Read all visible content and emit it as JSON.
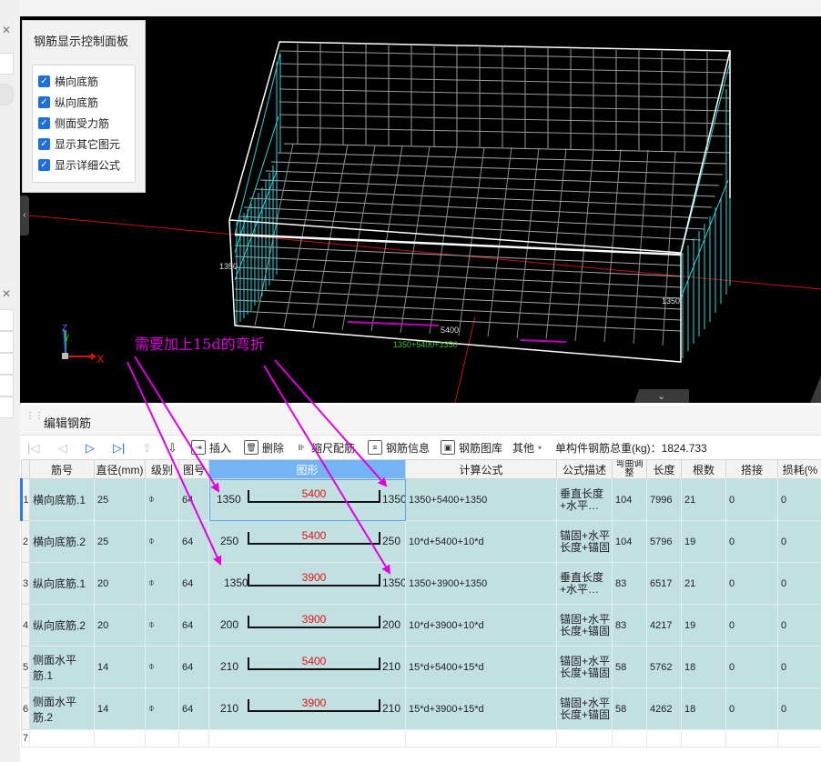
{
  "viewport": {
    "panel_title": "钢筋显示控制面板",
    "checkboxes": [
      {
        "label": "横向底筋",
        "checked": true
      },
      {
        "label": "纵向底筋",
        "checked": true
      },
      {
        "label": "侧面受力筋",
        "checked": true
      },
      {
        "label": "显示其它图元",
        "checked": true
      },
      {
        "label": "显示详细公式",
        "checked": true
      }
    ],
    "dim_labels": {
      "left": "1350",
      "right": "1350",
      "center": "5400",
      "bottom_formula": "1350+5400+1350"
    },
    "axis": {
      "x": "X",
      "y": "Y",
      "z": "Z"
    },
    "annotation": "需要加上15d的弯折",
    "collapse_arrow": "‹",
    "bottom_arrow": "⌄"
  },
  "editor": {
    "title": "编辑钢筋",
    "toolbar": {
      "insert": "插入",
      "delete": "删除",
      "scale": "缩尺配筋",
      "info": "钢筋信息",
      "library": "钢筋图库",
      "other": "其他",
      "total_label": "单构件钢筋总重(kg)：1824.733"
    },
    "columns": [
      "筋号",
      "直径(mm)",
      "级别",
      "图号",
      "图形",
      "计算公式",
      "公式描述",
      "弯曲调整",
      "长度",
      "根数",
      "搭接",
      "损耗(%"
    ],
    "rows": [
      {
        "no": "1",
        "name": "横向底筋.1",
        "dia": "25",
        "grade": "⌽",
        "fig": "64",
        "left": "1350",
        "mid": "5400",
        "right": "1350",
        "formula": "1350+5400+1350",
        "desc": "垂直长度+水平…",
        "bend": "104",
        "len": "7996",
        "count": "21",
        "lap": "0",
        "loss": "0"
      },
      {
        "no": "2",
        "name": "横向底筋.2",
        "dia": "25",
        "grade": "⌽",
        "fig": "64",
        "left": "250",
        "mid": "5400",
        "right": "250",
        "formula": "10*d+5400+10*d",
        "desc": "锚固+水平长度+锚固",
        "bend": "104",
        "len": "5796",
        "count": "19",
        "lap": "0",
        "loss": "0"
      },
      {
        "no": "3",
        "name": "纵向底筋.1",
        "dia": "20",
        "grade": "⌽",
        "fig": "64",
        "left": "1350",
        "mid": "3900",
        "right": "1350",
        "formula": "1350+3900+1350",
        "desc": "垂直长度+水平…",
        "bend": "83",
        "len": "6517",
        "count": "21",
        "lap": "0",
        "loss": "0"
      },
      {
        "no": "4",
        "name": "纵向底筋.2",
        "dia": "20",
        "grade": "⌽",
        "fig": "64",
        "left": "200",
        "mid": "3900",
        "right": "200",
        "formula": "10*d+3900+10*d",
        "desc": "锚固+水平长度+锚固",
        "bend": "83",
        "len": "4217",
        "count": "19",
        "lap": "0",
        "loss": "0"
      },
      {
        "no": "5",
        "name": "侧面水平筋.1",
        "dia": "14",
        "grade": "⌽",
        "fig": "64",
        "left": "210",
        "mid": "5400",
        "right": "210",
        "formula": "15*d+5400+15*d",
        "desc": "锚固+水平长度+锚固",
        "bend": "58",
        "len": "5762",
        "count": "18",
        "lap": "0",
        "loss": "0"
      },
      {
        "no": "6",
        "name": "侧面水平筋.2",
        "dia": "14",
        "grade": "⌽",
        "fig": "64",
        "left": "210",
        "mid": "3900",
        "right": "210",
        "formula": "15*d+3900+15*d",
        "desc": "锚固+水平长度+锚固",
        "bend": "58",
        "len": "4262",
        "count": "18",
        "lap": "0",
        "loss": "0"
      }
    ],
    "empty_row_no": "7"
  },
  "colors": {
    "annotation": "#e000e0",
    "cyan_rebar": "#27d8e0",
    "row_bg": "#c2dfe2",
    "selected_header": "#74b3f4"
  }
}
